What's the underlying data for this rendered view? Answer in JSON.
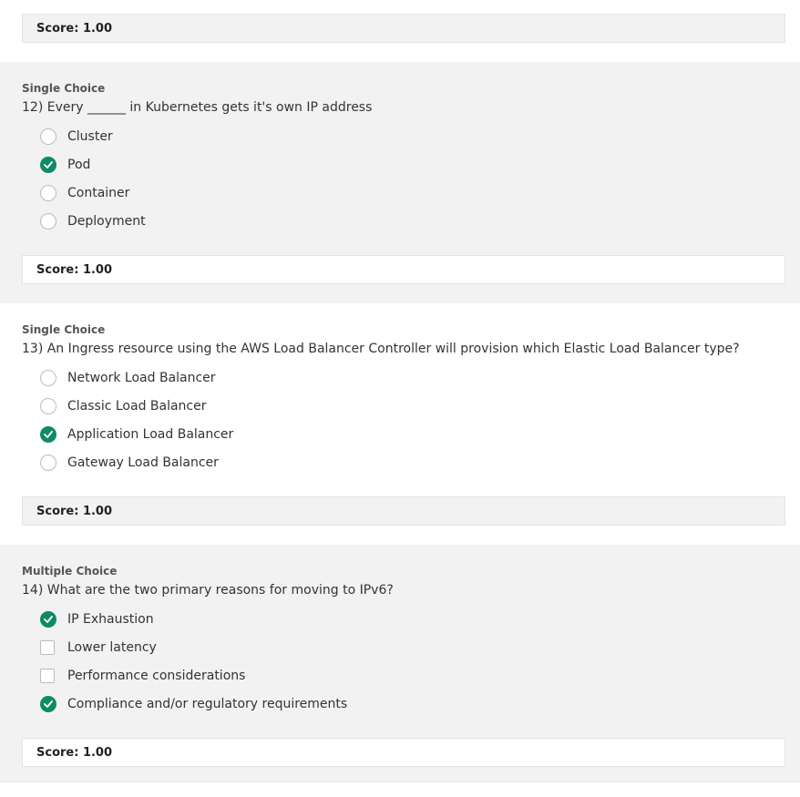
{
  "top_score": {
    "label": "Score: 1.00"
  },
  "questions": [
    {
      "type": "Single Choice",
      "text": "12) Every ______ in Kubernetes gets it's own IP address",
      "options": [
        {
          "label": "Cluster",
          "selected": false
        },
        {
          "label": "Pod",
          "selected": true
        },
        {
          "label": "Container",
          "selected": false
        },
        {
          "label": "Deployment",
          "selected": false
        }
      ],
      "score": "Score: 1.00"
    },
    {
      "type": "Single Choice",
      "text": "13) An Ingress resource using the AWS Load Balancer Controller will provision which Elastic Load Balancer type?",
      "options": [
        {
          "label": "Network Load Balancer",
          "selected": false
        },
        {
          "label": "Classic Load Balancer",
          "selected": false
        },
        {
          "label": "Application Load Balancer",
          "selected": true
        },
        {
          "label": "Gateway Load Balancer",
          "selected": false
        }
      ],
      "score": "Score: 1.00"
    },
    {
      "type": "Multiple Choice",
      "text": "14) What are the two primary reasons for moving to IPv6?",
      "options": [
        {
          "label": "IP Exhaustion",
          "selected": true
        },
        {
          "label": "Lower latency",
          "selected": false
        },
        {
          "label": "Performance considerations",
          "selected": false
        },
        {
          "label": "Compliance and/or regulatory requirements",
          "selected": true
        }
      ],
      "score": "Score: 1.00"
    }
  ],
  "colors": {
    "accent": "#0f8a67",
    "band_gray": "#f1f2f1"
  },
  "icons": {
    "selected": "check-circle-icon",
    "radio": "radio-icon",
    "checkbox": "checkbox-icon"
  }
}
